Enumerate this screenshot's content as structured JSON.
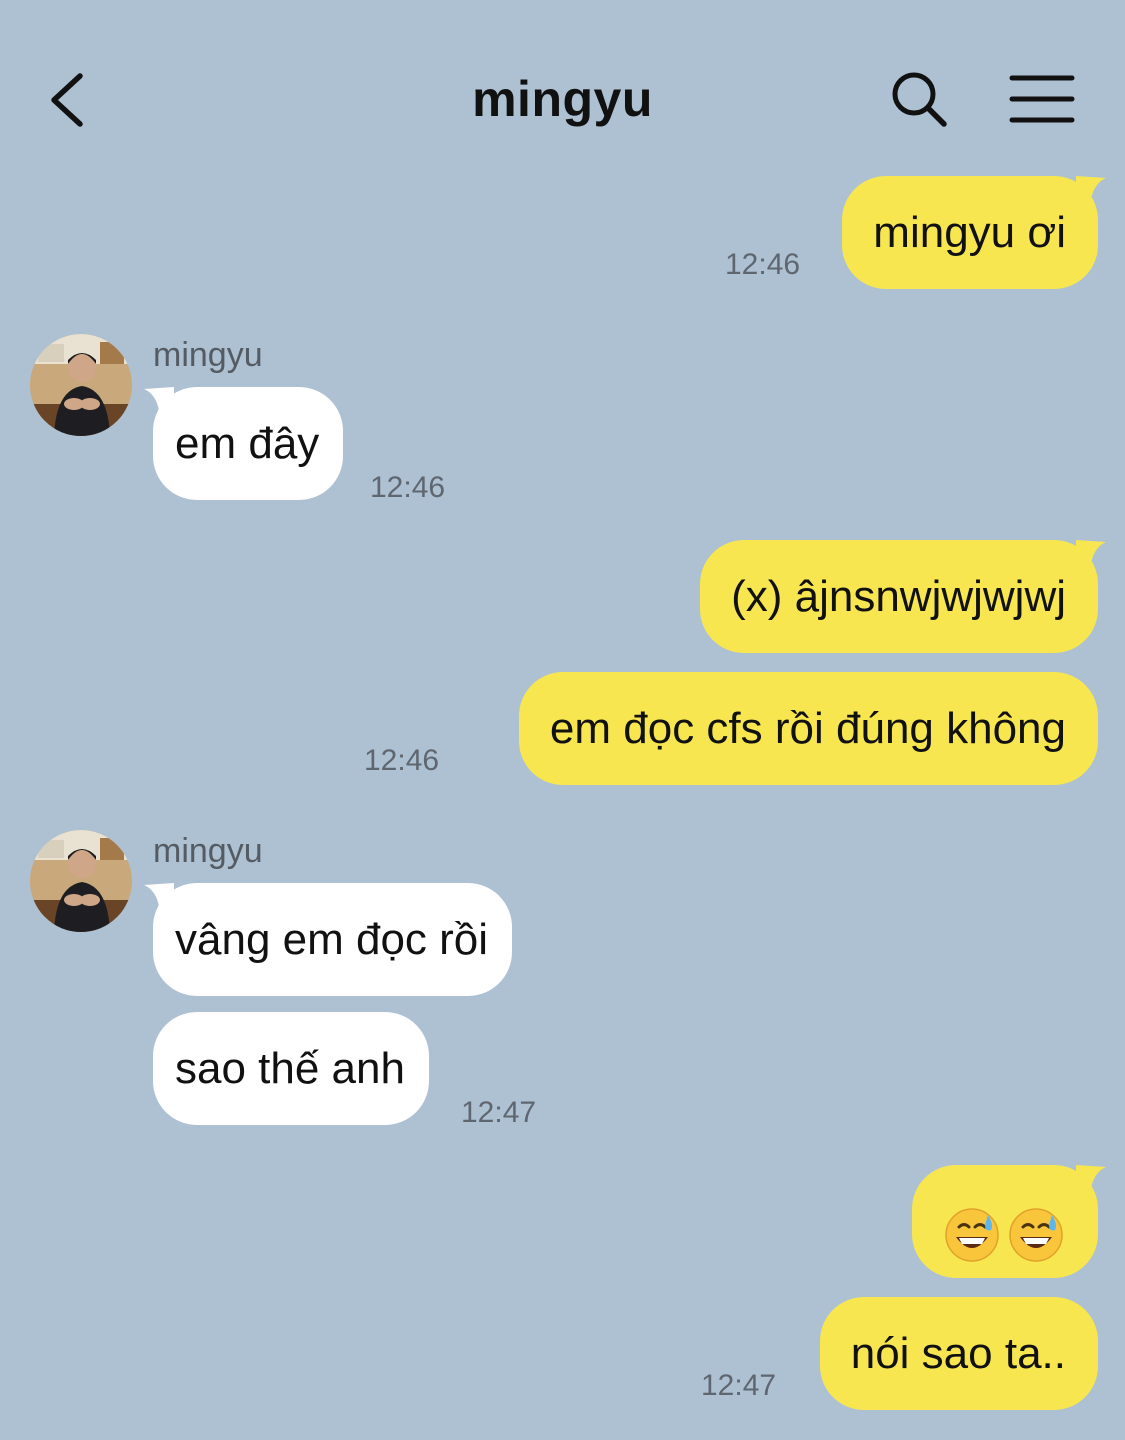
{
  "colors": {
    "background": "#aec1d3",
    "sent_bubble": "#f7e650",
    "received_bubble": "#ffffff",
    "text": "#111111",
    "meta_text": "#5f6670"
  },
  "header": {
    "title": "mingyu",
    "back_icon": "chevron-left-icon",
    "search_icon": "search-icon",
    "menu_icon": "hamburger-menu-icon"
  },
  "messages": [
    {
      "side": "sent",
      "text": "mingyu ơi",
      "time": "12:46"
    },
    {
      "side": "received",
      "sender": "mingyu",
      "text": "em đây",
      "time": "12:46"
    },
    {
      "side": "sent",
      "text": "(x) âjnsnwjwjwjwj"
    },
    {
      "side": "sent",
      "text": "em đọc cfs rồi đúng không",
      "time": "12:46"
    },
    {
      "side": "received",
      "sender": "mingyu",
      "text": "vâng em đọc rồi"
    },
    {
      "side": "received",
      "text": "sao thế anh",
      "time": "12:47"
    },
    {
      "side": "sent",
      "emoji": [
        "😅",
        "😅"
      ],
      "emoji_icon": "grinning-face-with-sweat-emoji"
    },
    {
      "side": "sent",
      "text": "nói sao ta..",
      "time": "12:47"
    }
  ]
}
